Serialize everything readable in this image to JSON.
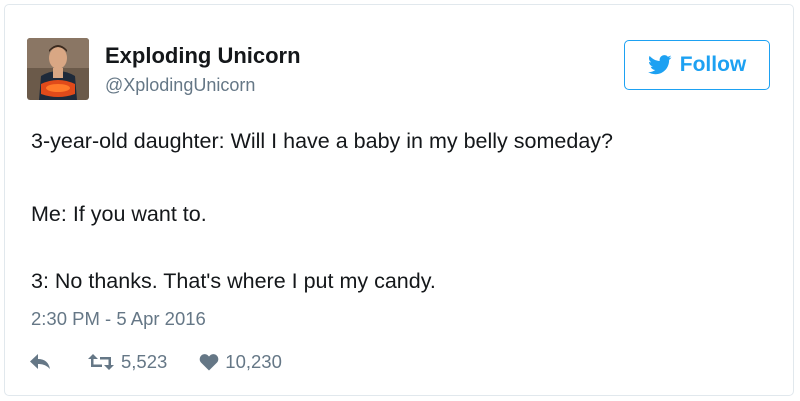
{
  "tweet": {
    "author": {
      "display_name": "Exploding Unicorn",
      "handle": "@XplodingUnicorn",
      "avatar_icon": "profile-photo"
    },
    "follow_button": {
      "label": "Follow",
      "icon": "twitter-bird-icon"
    },
    "text_lines": [
      "3-year-old daughter: Will I have a baby in my belly someday?",
      "Me: If you want to.",
      "3: No thanks. That's where I put my candy."
    ],
    "timestamp": "2:30 PM - 5 Apr 2016",
    "actions": {
      "reply_icon": "reply-icon",
      "retweet_icon": "retweet-icon",
      "retweets": "5,523",
      "like_icon": "heart-icon",
      "likes": "10,230"
    }
  },
  "colors": {
    "accent": "#1da1f2",
    "text": "#14171a",
    "secondary_text": "#657786",
    "border": "#e1e8ed"
  }
}
